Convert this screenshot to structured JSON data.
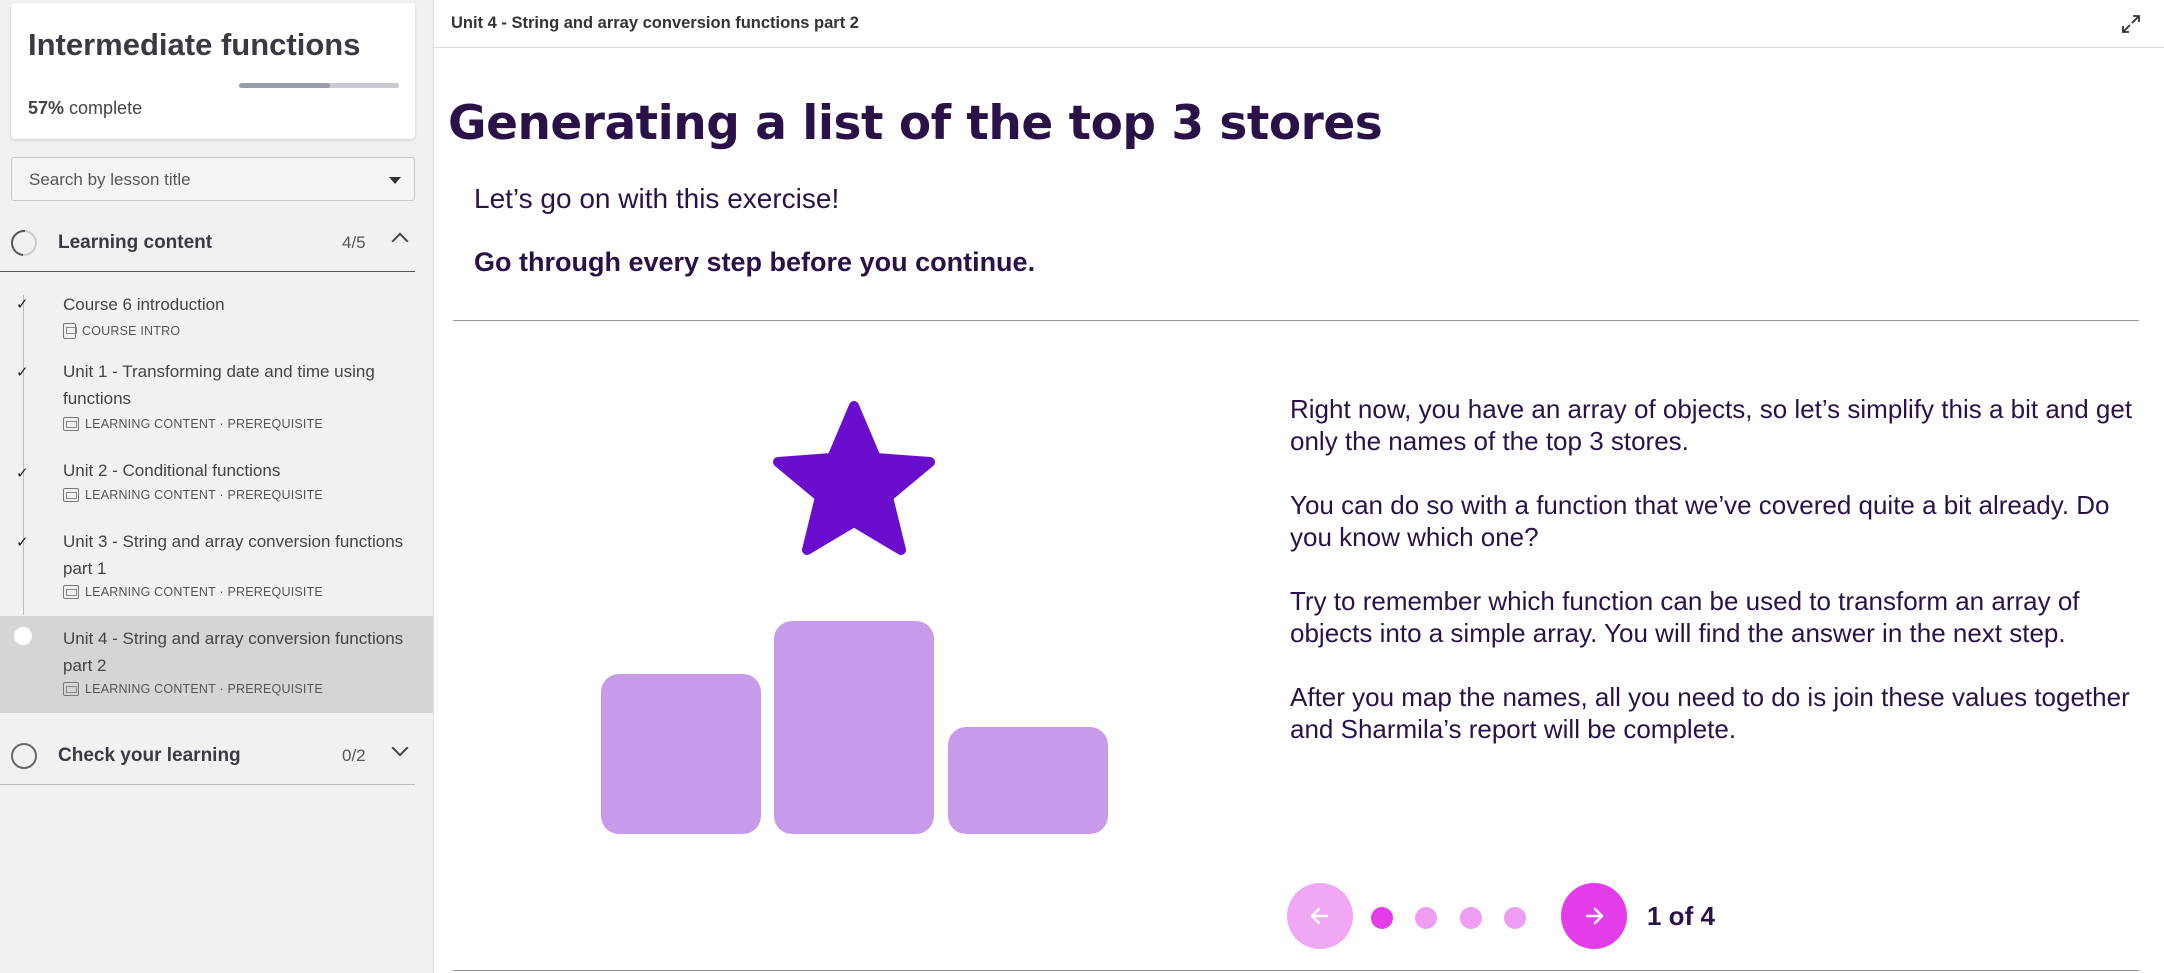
{
  "course": {
    "title": "Intermediate functions",
    "progress_percent": "57%",
    "progress_suffix": "complete",
    "progress_fraction": 0.57
  },
  "search": {
    "placeholder": "Search by lesson title"
  },
  "sections": {
    "learning": {
      "label": "Learning content",
      "count": "4/5"
    },
    "check": {
      "label": "Check your learning",
      "count": "0/2"
    }
  },
  "lessons": [
    {
      "title": "Course 6 introduction",
      "meta": "COURSE INTRO",
      "icon": "document-icon",
      "done": true
    },
    {
      "title": "Unit 1 - Transforming date and time using functions",
      "meta": "LEARNING CONTENT · PREREQUISITE",
      "icon": "slides-icon",
      "done": true
    },
    {
      "title": "Unit 2 - Conditional functions",
      "meta": "LEARNING CONTENT · PREREQUISITE",
      "icon": "slides-icon",
      "done": true
    },
    {
      "title": "Unit 3 - String and array conversion functions part 1",
      "meta": "LEARNING CONTENT · PREREQUISITE",
      "icon": "slides-icon",
      "done": true
    },
    {
      "title": "Unit 4 - String and array conversion functions part 2",
      "meta": "LEARNING CONTENT · PREREQUISITE",
      "icon": "slides-icon",
      "done": false,
      "active": true
    }
  ],
  "topbar": {
    "title": "Unit 4 - String and array conversion functions part 2"
  },
  "content": {
    "title": "Generating a list of the top 3 stores",
    "intro": "Let’s go on with this exercise!",
    "instruction": "Go through every step before you continue.",
    "paragraphs": [
      "Right now, you have an array of objects, so let’s simplify this a bit and get only the names of the top 3 stores.",
      "You can do so with a function that we’ve covered quite a bit already. Do you know which one?",
      "Try to remember which function can be used to transform an array of objects into a simple array. You will find the answer in the next step.",
      "After you map the names, all you need to do is join these values together and Sharmila’s report will be complete."
    ]
  },
  "stepper": {
    "label": "1 of 4",
    "current": 1,
    "total": 4
  },
  "colors": {
    "accent": "#e23de9",
    "accent_light": "#f0a8f5",
    "dot_active": "#e23de9",
    "dot_inactive": "#ef9cf3",
    "title_text": "#2a1249",
    "star": "#6a0dcc",
    "podium": "#c79bea"
  }
}
